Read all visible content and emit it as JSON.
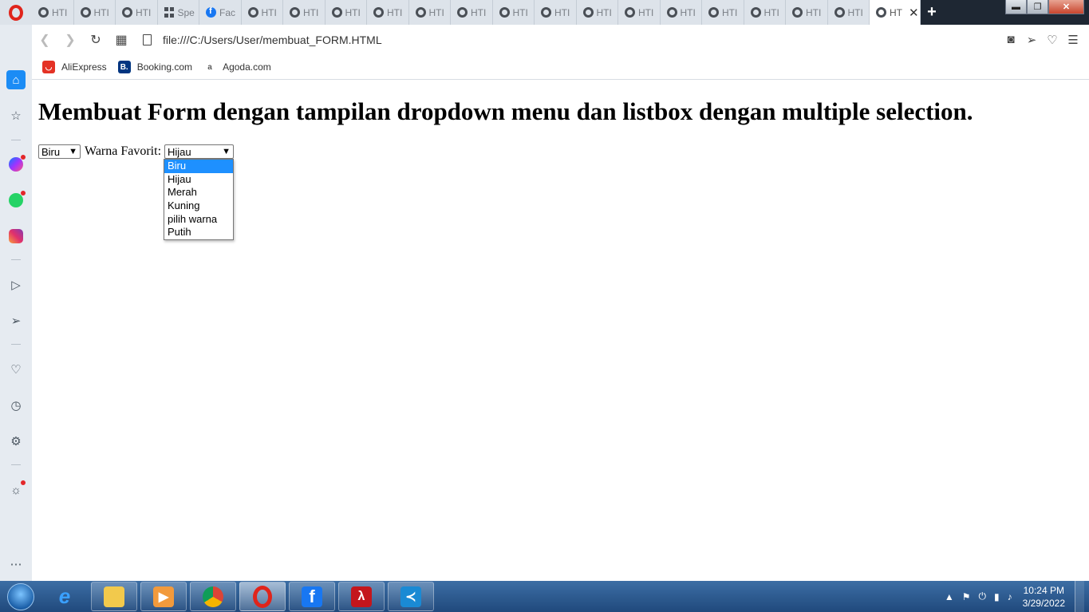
{
  "browser": {
    "tabs": [
      {
        "label": "HTI",
        "icon": "globe-icon"
      },
      {
        "label": "HTI",
        "icon": "globe-icon"
      },
      {
        "label": "HTI",
        "icon": "globe-icon"
      },
      {
        "label": "Spe",
        "icon": "speed-dial-icon"
      },
      {
        "label": "Fac",
        "icon": "facebook-icon"
      },
      {
        "label": "HTI",
        "icon": "globe-icon"
      },
      {
        "label": "HTI",
        "icon": "globe-icon"
      },
      {
        "label": "HTI",
        "icon": "globe-icon"
      },
      {
        "label": "HTI",
        "icon": "globe-icon"
      },
      {
        "label": "HTI",
        "icon": "globe-icon"
      },
      {
        "label": "HTI",
        "icon": "globe-icon"
      },
      {
        "label": "HTI",
        "icon": "globe-icon"
      },
      {
        "label": "HTI",
        "icon": "globe-icon"
      },
      {
        "label": "HTI",
        "icon": "globe-icon"
      },
      {
        "label": "HTI",
        "icon": "globe-icon"
      },
      {
        "label": "HTI",
        "icon": "globe-icon"
      },
      {
        "label": "HTI",
        "icon": "globe-icon"
      },
      {
        "label": "HTI",
        "icon": "globe-icon"
      },
      {
        "label": "HTI",
        "icon": "globe-icon"
      },
      {
        "label": "HTI",
        "icon": "globe-icon"
      }
    ],
    "active_tab": {
      "label": "HT",
      "icon": "globe-icon"
    },
    "new_tab_label": "+",
    "url": "file:///C:/Users/User/membuat_FORM.HTML",
    "bookmarks": [
      {
        "label": "AliExpress",
        "icon": "aliexpress-icon",
        "color": "#e43225"
      },
      {
        "label": "Booking.com",
        "icon": "booking-icon",
        "color": "#003580"
      },
      {
        "label": "Agoda.com",
        "icon": "agoda-icon",
        "color": "#5a5a5a"
      }
    ],
    "accent": "#1b8cf5"
  },
  "page": {
    "title": "Membuat Form dengan tampilan dropdown menu dan listbox dengan multiple selection.",
    "select1_value": "Biru",
    "label": "Warna Favorit:",
    "select2_value": "Hijau",
    "dropdown_options": [
      "Biru",
      "Hijau",
      "Merah",
      "Kuning",
      "pilih warna",
      "Putih"
    ],
    "dropdown_highlighted": "Biru"
  },
  "taskbar": {
    "apps": [
      "internet-explorer-icon",
      "file-explorer-icon",
      "media-player-icon",
      "chrome-icon",
      "opera-icon",
      "facebook-icon",
      "acrobat-icon",
      "vscode-icon"
    ],
    "time": "10:24 PM",
    "date": "3/29/2022"
  }
}
